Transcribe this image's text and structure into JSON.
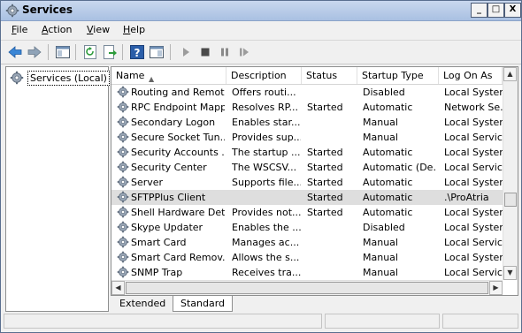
{
  "window": {
    "title": "Services",
    "controls": {
      "minimize": "_",
      "maximize": "□",
      "close": "X"
    }
  },
  "menu": [
    "File",
    "Action",
    "View",
    "Help"
  ],
  "toolbar": {
    "icons": [
      "back-arrow-icon",
      "forward-arrow-icon",
      "show-hide-console-tree-icon",
      "refresh-icon",
      "export-list-icon",
      "help-icon",
      "properties-icon",
      "start-service-icon",
      "stop-service-icon",
      "pause-service-icon",
      "restart-service-icon"
    ]
  },
  "tree": {
    "root_label": "Services (Local)"
  },
  "list": {
    "columns": [
      "Name",
      "Description",
      "Status",
      "Startup Type",
      "Log On As"
    ],
    "sort_indicator": "▲",
    "rows": [
      {
        "name": "Routing and Remot...",
        "description": "Offers routi...",
        "status": "",
        "startup": "Disabled",
        "logon": "Local System"
      },
      {
        "name": "RPC Endpoint Mapper",
        "description": "Resolves RP...",
        "status": "Started",
        "startup": "Automatic",
        "logon": "Network Se..."
      },
      {
        "name": "Secondary Logon",
        "description": "Enables star...",
        "status": "",
        "startup": "Manual",
        "logon": "Local System"
      },
      {
        "name": "Secure Socket Tun...",
        "description": "Provides sup...",
        "status": "",
        "startup": "Manual",
        "logon": "Local Service"
      },
      {
        "name": "Security Accounts ...",
        "description": "The startup ...",
        "status": "Started",
        "startup": "Automatic",
        "logon": "Local System"
      },
      {
        "name": "Security Center",
        "description": "The WSCSV...",
        "status": "Started",
        "startup": "Automatic (De...",
        "logon": "Local Service"
      },
      {
        "name": "Server",
        "description": "Supports file...",
        "status": "Started",
        "startup": "Automatic",
        "logon": "Local System"
      },
      {
        "name": "SFTPPlus Client",
        "description": "",
        "status": "Started",
        "startup": "Automatic",
        "logon": ".\\ProAtria",
        "selected": true
      },
      {
        "name": "Shell Hardware Det...",
        "description": "Provides not...",
        "status": "Started",
        "startup": "Automatic",
        "logon": "Local System"
      },
      {
        "name": "Skype Updater",
        "description": "Enables the ...",
        "status": "",
        "startup": "Disabled",
        "logon": "Local System"
      },
      {
        "name": "Smart Card",
        "description": "Manages ac...",
        "status": "",
        "startup": "Manual",
        "logon": "Local Service"
      },
      {
        "name": "Smart Card Remov...",
        "description": "Allows the s...",
        "status": "",
        "startup": "Manual",
        "logon": "Local System"
      },
      {
        "name": "SNMP Trap",
        "description": "Receives tra...",
        "status": "",
        "startup": "Manual",
        "logon": "Local Service"
      }
    ]
  },
  "tabs": [
    "Extended",
    "Standard"
  ],
  "active_tab": "Standard",
  "colors": {
    "title_bar": "#b9cce8",
    "selected_row": "#dedede",
    "help_icon": "#2b5ea9"
  }
}
